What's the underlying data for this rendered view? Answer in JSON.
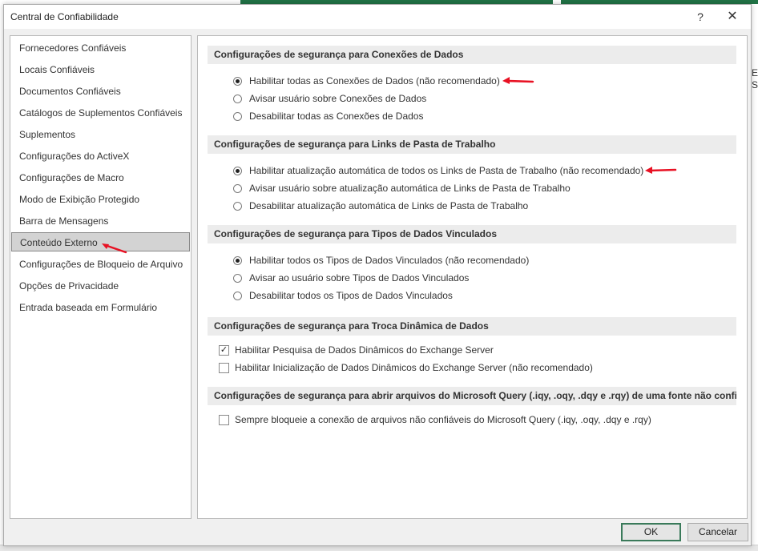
{
  "background_edge_text": "E\nS",
  "dialog": {
    "title": "Central de Confiabilidade",
    "help_label": "?",
    "close_label": "✕"
  },
  "nav": {
    "items": [
      {
        "label": "Fornecedores Confiáveis"
      },
      {
        "label": "Locais Confiáveis"
      },
      {
        "label": "Documentos Confiáveis"
      },
      {
        "label": "Catálogos de Suplementos Confiáveis"
      },
      {
        "label": "Suplementos"
      },
      {
        "label": "Configurações do ActiveX"
      },
      {
        "label": "Configurações de Macro"
      },
      {
        "label": "Modo de Exibição Protegido"
      },
      {
        "label": "Barra de Mensagens"
      },
      {
        "label": "Conteúdo Externo",
        "selected": true
      },
      {
        "label": "Configurações de Bloqueio de Arquivo"
      },
      {
        "label": "Opções de Privacidade"
      },
      {
        "label": "Entrada baseada em Formulário"
      }
    ]
  },
  "sections": [
    {
      "header": "Configurações de segurança para Conexões de Dados",
      "options": [
        {
          "label": "Habilitar todas as Conexões de Dados (não recomendado)",
          "checked": true
        },
        {
          "label": "Avisar usuário sobre Conexões de Dados",
          "checked": false
        },
        {
          "label": "Desabilitar todas as Conexões de Dados",
          "checked": false
        }
      ]
    },
    {
      "header": "Configurações de segurança para Links de Pasta de Trabalho",
      "options": [
        {
          "label": "Habilitar atualização automática de todos os Links de Pasta de Trabalho (não recomendado)",
          "checked": true
        },
        {
          "label": "Avisar usuário sobre atualização automática de Links de Pasta de Trabalho",
          "checked": false
        },
        {
          "label": "Desabilitar atualização automática de Links de Pasta de Trabalho",
          "checked": false
        }
      ]
    },
    {
      "header": "Configurações de segurança para Tipos de Dados Vinculados",
      "options": [
        {
          "label": "Habilitar todos os Tipos de Dados Vinculados (não recomendado)",
          "checked": true
        },
        {
          "label": "Avisar ao usuário sobre Tipos de Dados Vinculados",
          "checked": false
        },
        {
          "label": "Desabilitar todos os Tipos de Dados Vinculados",
          "checked": false
        }
      ]
    },
    {
      "header": "Configurações de segurança para Troca Dinâmica de Dados",
      "checks": [
        {
          "label": "Habilitar Pesquisa de Dados Dinâmicos do Exchange Server",
          "checked": true,
          "mark": "✓"
        },
        {
          "label": "Habilitar Inicialização de Dados Dinâmicos do Exchange Server (não recomendado)",
          "checked": false,
          "mark": ""
        }
      ]
    },
    {
      "header": "Configurações de segurança para abrir arquivos do Microsoft Query (.iqy, .oqy, .dqy e .rqy) de uma fonte não confiável",
      "checks": [
        {
          "label": "Sempre bloqueie a conexão de arquivos não confiáveis do Microsoft Query (.iqy, .oqy, .dqy e .rqy)",
          "checked": false,
          "mark": ""
        }
      ]
    }
  ],
  "buttons": {
    "ok": "OK",
    "cancel": "Cancelar"
  },
  "annotation_color": "#e81123"
}
